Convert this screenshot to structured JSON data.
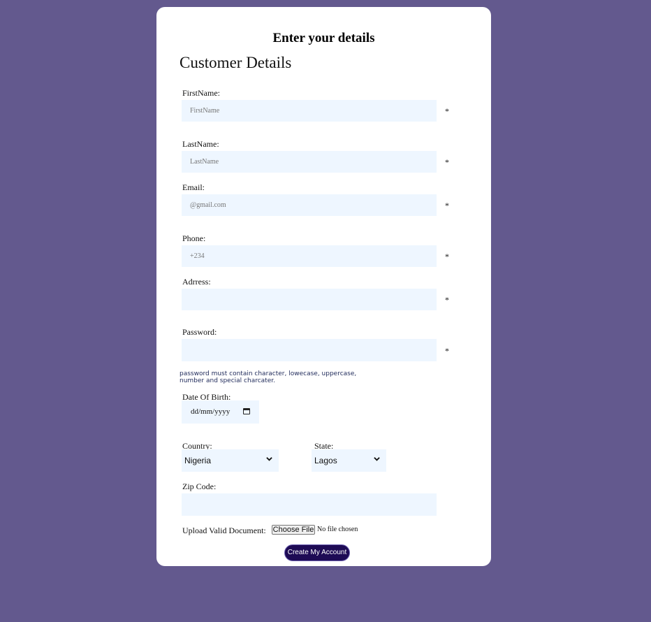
{
  "heading": "Enter your details",
  "section_title": "Customer Details",
  "fields": {
    "first_name": {
      "label": "FirstName:",
      "placeholder": "FirstName",
      "required_mark": "*"
    },
    "last_name": {
      "label": "LastName:",
      "placeholder": "LastName",
      "required_mark": "*"
    },
    "email": {
      "label": "Email:",
      "placeholder": "@gmail.com",
      "required_mark": "*"
    },
    "phone": {
      "label": "Phone:",
      "placeholder": "+234",
      "required_mark": "*"
    },
    "address": {
      "label": "Adrress:",
      "placeholder": "",
      "required_mark": "*"
    },
    "password": {
      "label": "Password:",
      "placeholder": "",
      "required_mark": "*",
      "hint": "password must contain character, lowecase, uppercase, number and special charcater."
    },
    "dob": {
      "label": "Date Of Birth:",
      "placeholder": "dd/mm/yyyy",
      "icon": "calendar-icon"
    },
    "country": {
      "label": "Country:",
      "value": "Nigeria",
      "icon": "chevron-down-icon"
    },
    "state": {
      "label": "State:",
      "value": "Lagos",
      "icon": "chevron-down-icon"
    },
    "zip": {
      "label": "Zip Code:",
      "placeholder": ""
    },
    "upload": {
      "label": "Upload Valid Document:",
      "button": "Choose File",
      "status": "No file chosen"
    }
  },
  "submit_label": "Create My Account",
  "colors": {
    "background": "#63598e",
    "card": "#ffffff",
    "field_bg": "#eef6ff",
    "button_bg": "#1e0b55"
  }
}
